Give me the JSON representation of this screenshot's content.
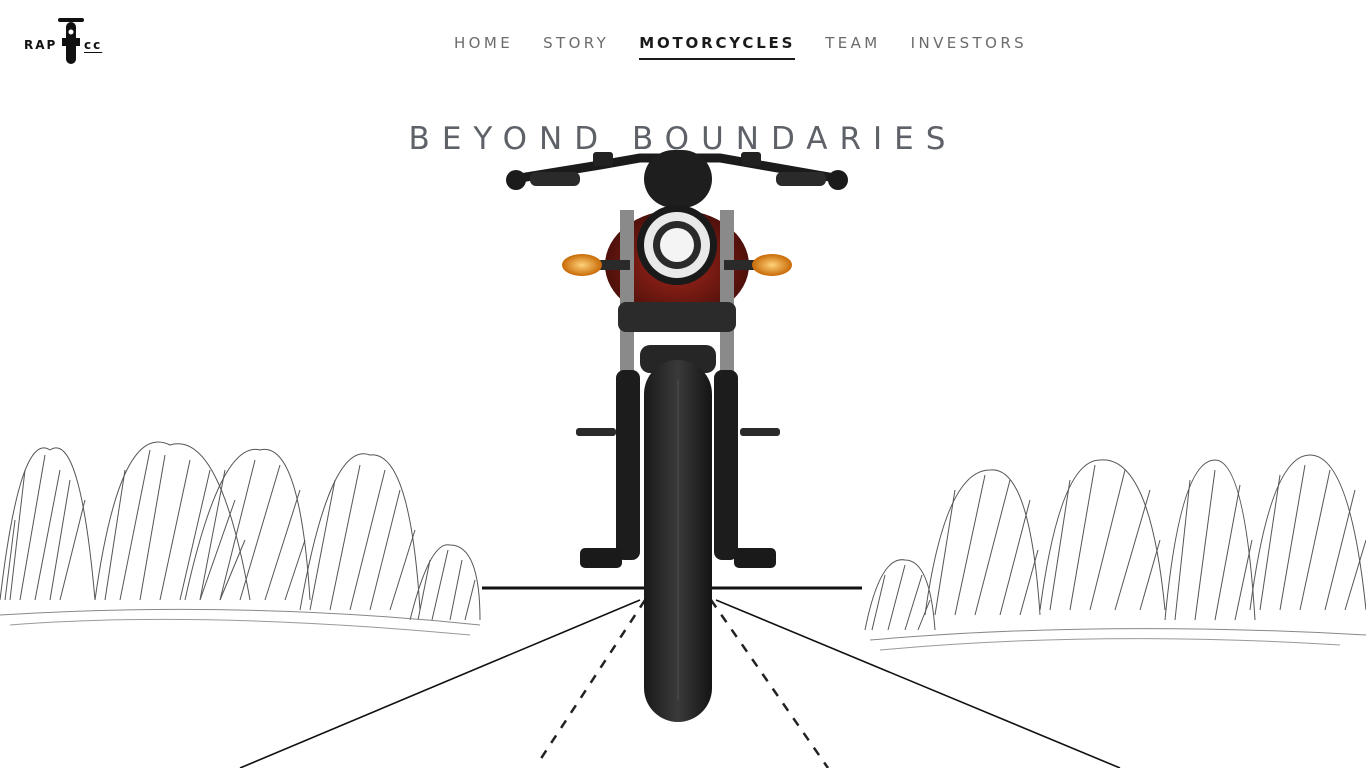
{
  "brand": {
    "text_left": "RAP",
    "text_right": "cc",
    "logo_icon": "motorcycle-front-icon"
  },
  "nav": {
    "items": [
      {
        "label": "HOME",
        "active": false
      },
      {
        "label": "STORY",
        "active": false
      },
      {
        "label": "MOTORCYCLES",
        "active": true
      },
      {
        "label": "TEAM",
        "active": false
      },
      {
        "label": "INVESTORS",
        "active": false
      }
    ]
  },
  "hero": {
    "headline": "BEYOND BOUNDARIES",
    "image": "motorcycle-front-view",
    "background": "sketched-bushes-and-road"
  },
  "colors": {
    "headline": "#5e6268",
    "nav_inactive": "#6b6b6b",
    "nav_active": "#1a1a1a",
    "headlight_accent": "#f39c12",
    "tank_red": "#7a1c14"
  }
}
